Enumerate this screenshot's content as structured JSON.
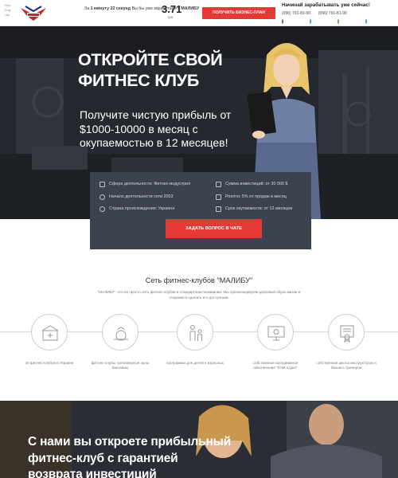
{
  "topbar": {
    "langs": [
      "Rus",
      "Eng",
      "Ukr"
    ],
    "promo_prefix": "За ",
    "promo_time": "1 минуту 22 секунд",
    "promo_mid": " Вы бы уже заработали с ",
    "promo_brand": "МАЛИБУ",
    "price_value": "3.71",
    "price_unit": "грн",
    "plan_button": "Получить бизнес-план",
    "contact_title": "Начинай зарабатывать уже сейчас!",
    "phone_1": "(096) 791-81-90",
    "phone_2": "(096) 791-81-90",
    "icon_colors": [
      "#7b519d",
      "#2ca5e0",
      "#4caf50",
      "#2ca5e0"
    ]
  },
  "hero": {
    "title_line1": "ОТКРОЙТЕ СВОЙ",
    "title_line2": "ФИТНЕС КЛУБ",
    "subtitle": "Получите чистую прибыль от $1000-10000 в месяц с окупаемостью в 12 месяцев!"
  },
  "panel": {
    "left": [
      {
        "icon": "dumbbell-icon",
        "text": "Сфера деятельности: Фитнес-индустрия"
      },
      {
        "icon": "clock-icon",
        "text": "Начало деятельности сети 2003"
      },
      {
        "icon": "globe-icon",
        "text": "Страна происхождения: Украина"
      }
    ],
    "right": [
      {
        "icon": "wallet-icon",
        "text": "Сумма инвестиций: от 30 000 $"
      },
      {
        "icon": "coins-icon",
        "text": "Роялти: 5% от продаж в месяц"
      },
      {
        "icon": "calendar-icon",
        "text": "Срок окупаемости: от 12 месяцев"
      }
    ],
    "chat_button": "Задать вопрос в чате"
  },
  "about": {
    "title": "Сеть фитнес-клубов \"МАЛИБУ\"",
    "desc": "\"МАЛИБУ\" -это не просто сеть фитнес-клубов в стандартном понимании. Мы пропагандируем здоровый образ жизни и стараемся сделать его доступным.",
    "features": [
      {
        "icon": "clinic-icon",
        "label": "30 фитнес-клубов в Украине"
      },
      {
        "icon": "kettlebell-icon",
        "label": "фитнес-клубы тренажерные залы бассейны"
      },
      {
        "icon": "family-icon",
        "label": "программы для детей и взрослых"
      },
      {
        "icon": "computer-gear-icon",
        "label": "собственное программное обеспечение \"SAM отдел\""
      },
      {
        "icon": "certificate-icon",
        "label": "собственная школа инструкторов и бизнесс-тренеров"
      }
    ]
  },
  "hero2": {
    "title_line1": "С нами вы откроете прибыльный",
    "title_line2": "фитнес-клуб с гарантией",
    "title_line3": "возврата инвестиций"
  }
}
